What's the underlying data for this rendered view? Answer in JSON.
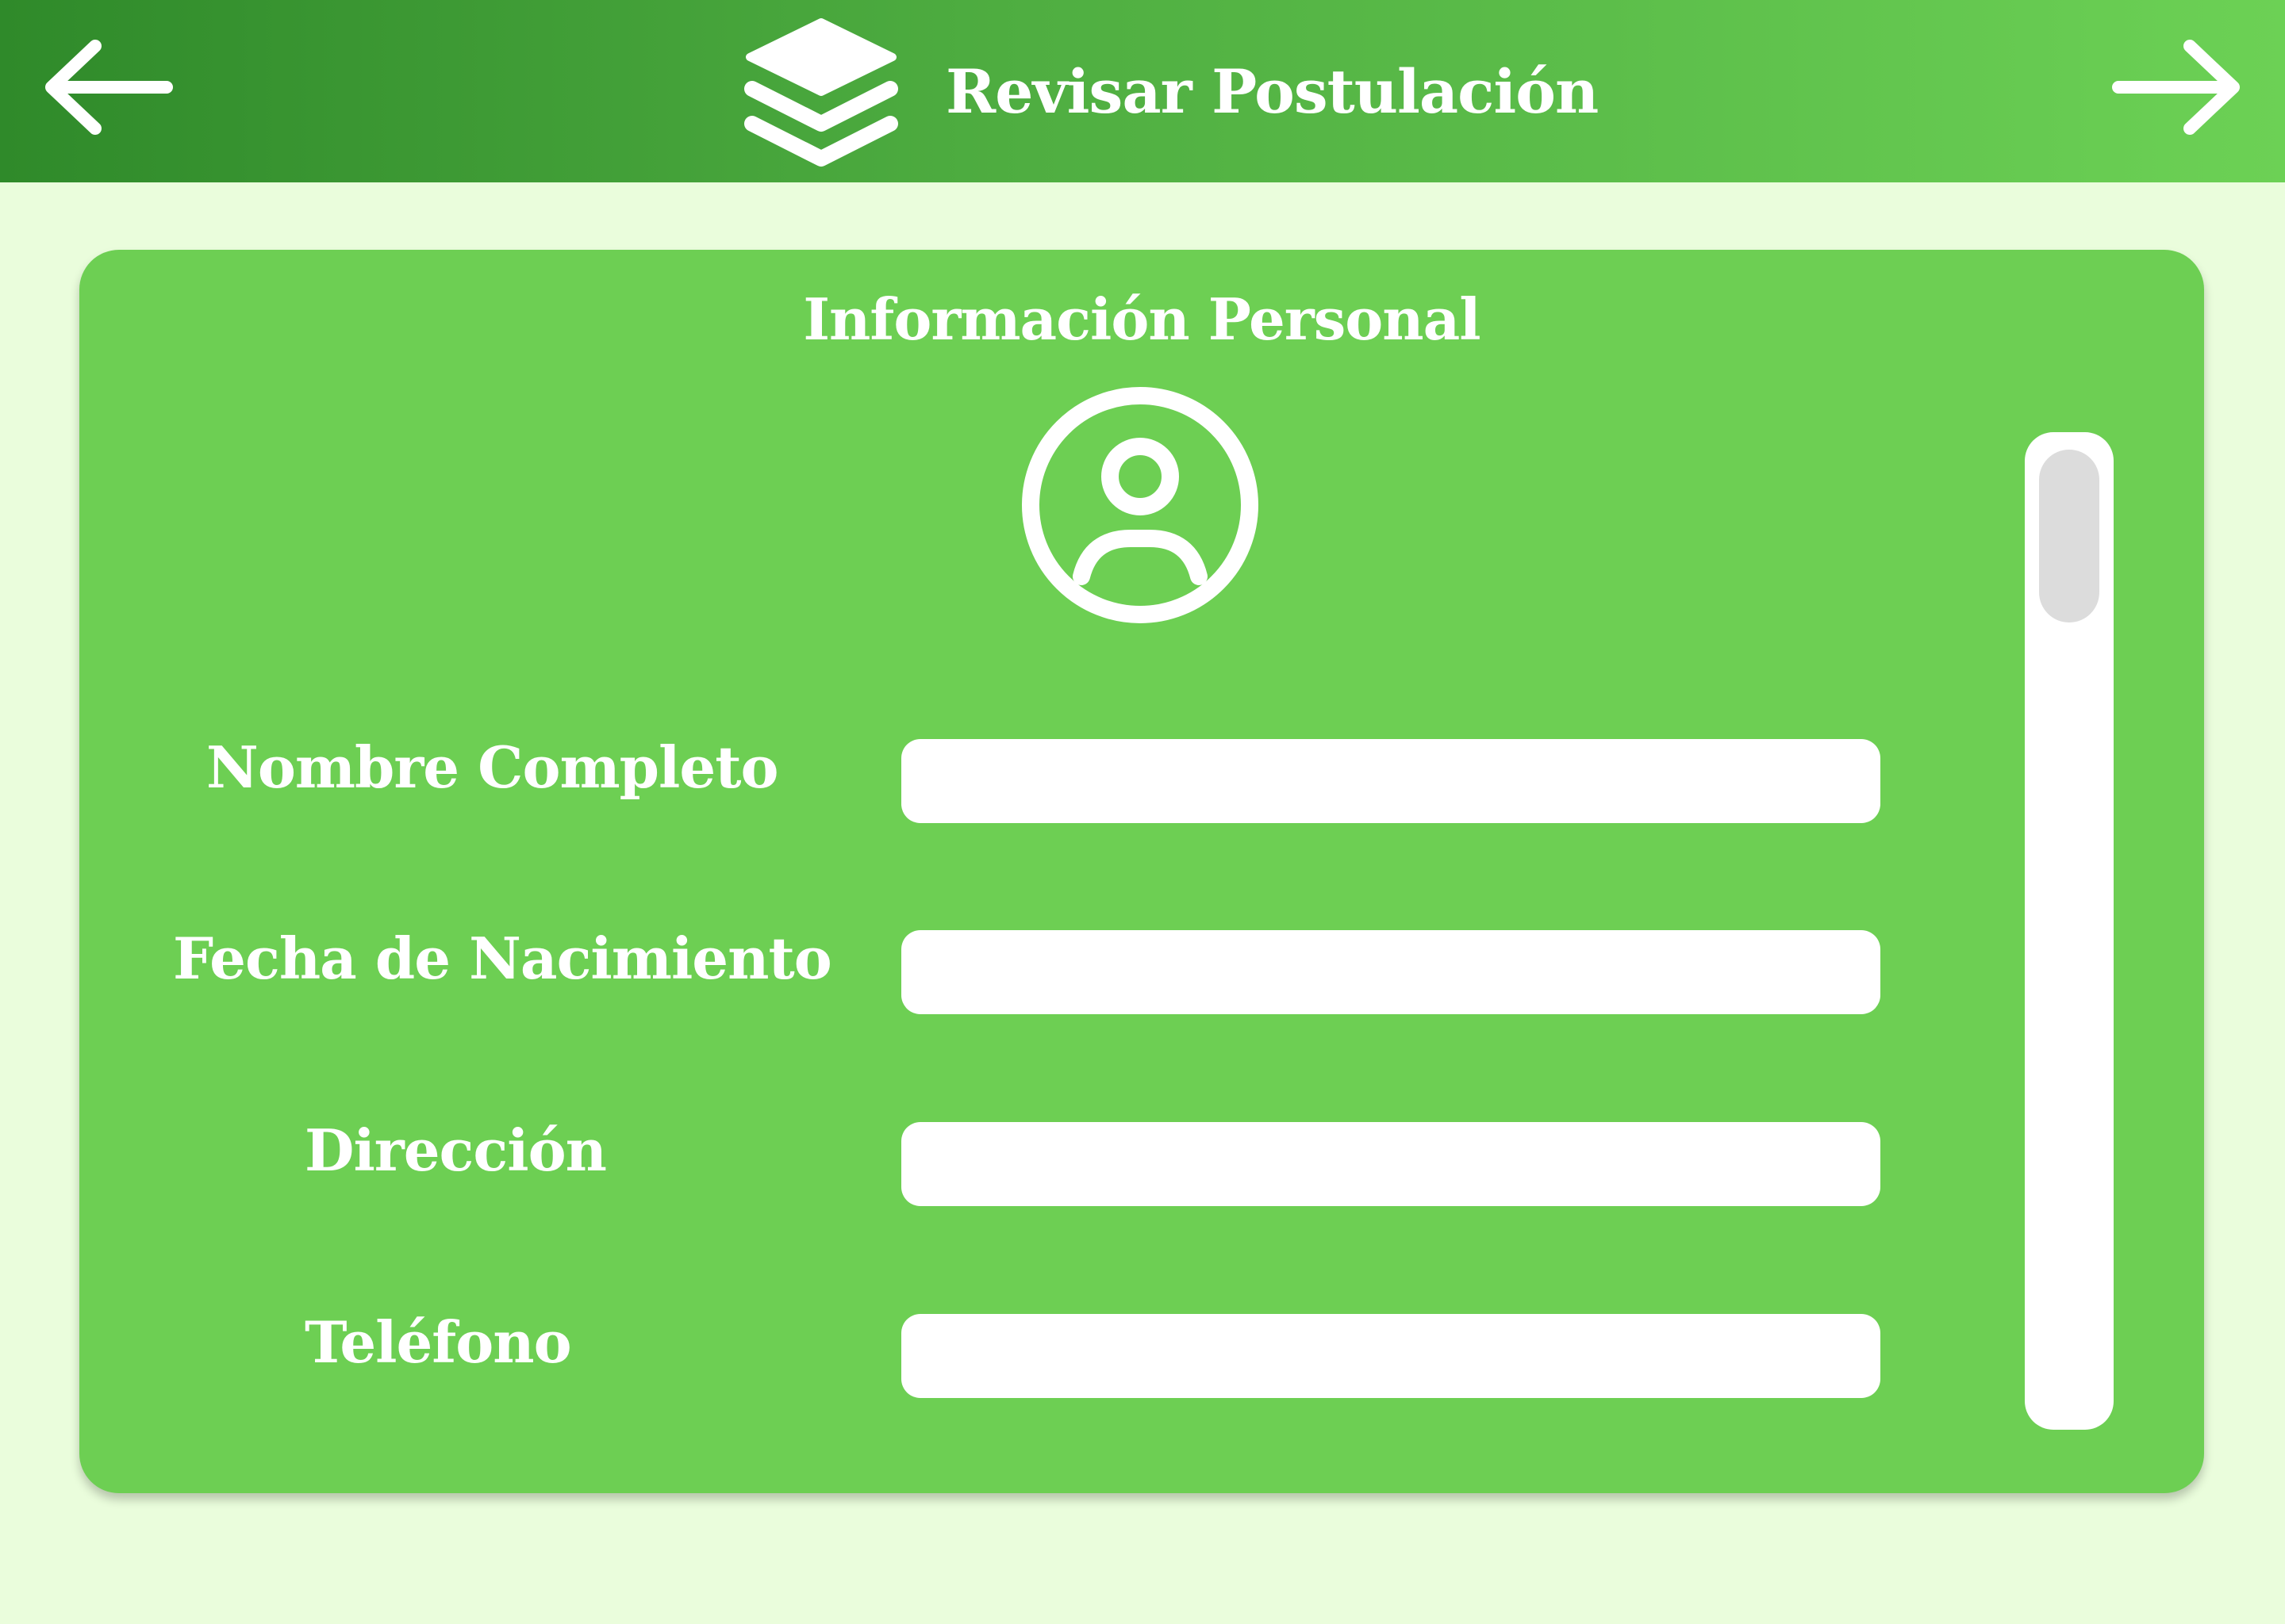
{
  "header": {
    "title": "Revisar Postulación",
    "back_icon": "arrow-left-icon",
    "forward_icon": "arrow-right-icon",
    "logo_icon": "layers-icon"
  },
  "section": {
    "title": "Información Personal",
    "avatar_icon": "user-circle-icon"
  },
  "fields": [
    {
      "label": "Nombre Completo",
      "value": ""
    },
    {
      "label": "Fecha de Nacimiento",
      "value": ""
    },
    {
      "label": "Dirección",
      "value": ""
    },
    {
      "label": "Teléfono",
      "value": ""
    }
  ],
  "colors": {
    "background": "#eafddc",
    "header_start": "#2f8a2a",
    "header_end": "#6cd155",
    "card": "#6dcf53",
    "text": "#ffffff",
    "scroll_thumb": "#dcdcdc"
  }
}
